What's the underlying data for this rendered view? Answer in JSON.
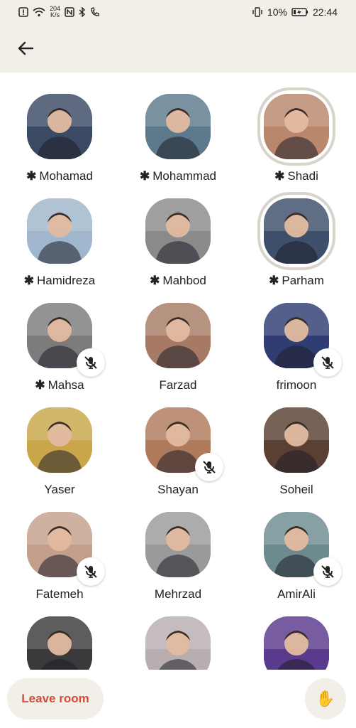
{
  "status_bar": {
    "speed_value": "204",
    "speed_unit": "K/s",
    "battery": "10%",
    "time": "22:44"
  },
  "header": {
    "back_icon": "arrow-left-icon"
  },
  "participants": [
    {
      "name": "Mohamad",
      "moderator": true,
      "muted": false,
      "speaking": false,
      "color": "#3b4a63"
    },
    {
      "name": "Mohammad",
      "moderator": true,
      "muted": false,
      "speaking": false,
      "color": "#5d7a8c"
    },
    {
      "name": "Shadi",
      "moderator": true,
      "muted": false,
      "speaking": true,
      "color": "#b9876c"
    },
    {
      "name": "Hamidreza",
      "moderator": true,
      "muted": false,
      "speaking": false,
      "color": "#9fb6cc"
    },
    {
      "name": "Mahbod",
      "moderator": true,
      "muted": false,
      "speaking": false,
      "color": "#8a8a8a"
    },
    {
      "name": "Parham",
      "moderator": true,
      "muted": false,
      "speaking": true,
      "color": "#3d4f6b"
    },
    {
      "name": "Mahsa",
      "moderator": true,
      "muted": true,
      "speaking": false,
      "color": "#7c7c7c"
    },
    {
      "name": "Farzad",
      "moderator": false,
      "muted": false,
      "speaking": false,
      "color": "#a67a64"
    },
    {
      "name": "frimoon",
      "moderator": false,
      "muted": true,
      "speaking": false,
      "color": "#2f3d72"
    },
    {
      "name": "Yaser",
      "moderator": false,
      "muted": false,
      "speaking": false,
      "color": "#c9a64a"
    },
    {
      "name": "Shayan",
      "moderator": false,
      "muted": true,
      "speaking": false,
      "color": "#b07a5c"
    },
    {
      "name": "Soheil",
      "moderator": false,
      "muted": false,
      "speaking": false,
      "color": "#5a4032"
    },
    {
      "name": "Fatemeh",
      "moderator": false,
      "muted": true,
      "speaking": false,
      "color": "#c4a08c"
    },
    {
      "name": "Mehrzad",
      "moderator": false,
      "muted": false,
      "speaking": false,
      "color": "#9a9a9a"
    },
    {
      "name": "AmirAli",
      "moderator": false,
      "muted": true,
      "speaking": false,
      "color": "#6d8b8f"
    },
    {
      "name": "",
      "moderator": false,
      "muted": false,
      "speaking": false,
      "color": "#3a3a3a"
    },
    {
      "name": "",
      "moderator": false,
      "muted": false,
      "speaking": false,
      "color": "#b8aeb0"
    },
    {
      "name": "",
      "moderator": false,
      "muted": false,
      "speaking": false,
      "color": "#5a3a8c"
    }
  ],
  "footer": {
    "leave_label": "Leave room",
    "hand_icon": "raised-hand-icon"
  }
}
